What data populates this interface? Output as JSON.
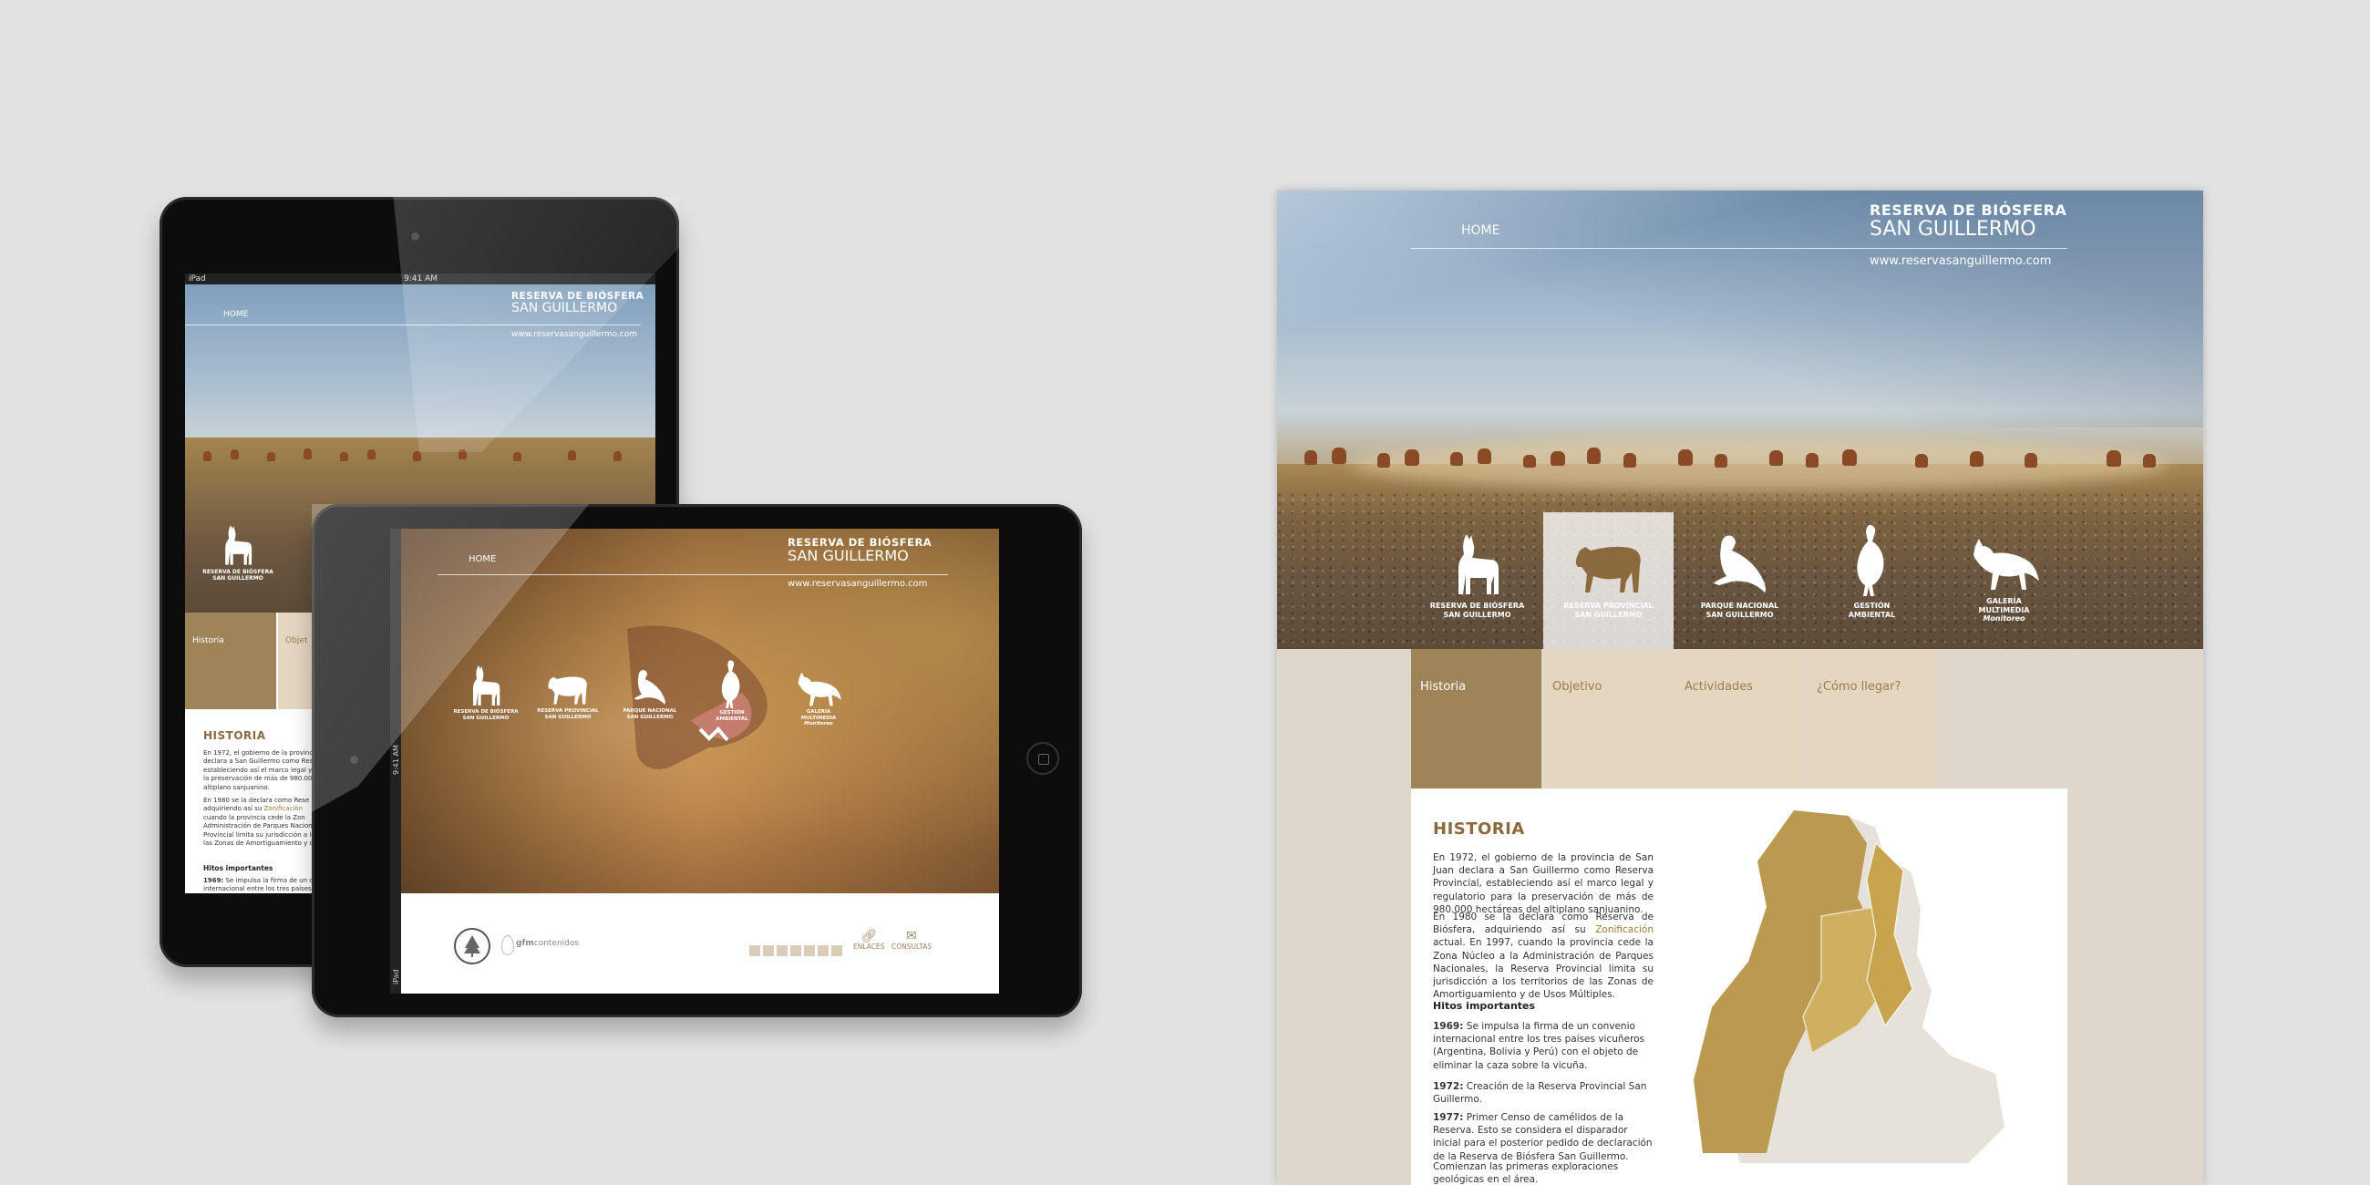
{
  "site": {
    "brand_line1": "RESERVA DE BIÓSFERA",
    "brand_line2": "SAN GUILLERMO",
    "url": "www.reservasanguillermo.com",
    "nav_home": "HOME",
    "animals": [
      {
        "icon": "vicuna-icon",
        "line1": "RESERVA DE BIÓSFERA",
        "line2": "SAN GUILLERMO"
      },
      {
        "icon": "puma-icon",
        "line1": "RESERVA PROVINCIAL",
        "line2": "SAN GUILLERMO"
      },
      {
        "icon": "condor-icon",
        "line1": "PARQUE NACIONAL",
        "line2": "SAN GUILLERMO"
      },
      {
        "icon": "rhea-icon",
        "line1": "GESTIÓN",
        "line2": "AMBIENTAL"
      },
      {
        "icon": "fox-icon",
        "line1": "GALERÍA",
        "line2": "MULTIMEDIA",
        "line3": "Monitoreo"
      }
    ],
    "tabs": [
      "Historia",
      "Objetivo",
      "Actividades",
      "¿Cómo llegar?"
    ],
    "historia_title": "HISTORIA",
    "para1": "En 1972, el gobierno de la provincia de San Juan declara a San Guillermo como Reserva Provincial, estableciendo así el marco legal y regulatorio para la preservación de más de 980.000 hectáreas del altiplano sanjuanino.",
    "para2_a": "En 1980 se la declara como Reserva de Biósfera, adquiriendo así su ",
    "para2_link": "Zonificación",
    "para2_b": " actual. En 1997, cuando la provincia cede la Zona Núcleo a la Administración de Parques Nacionales, la Reserva Provincial limita su jurisdicción a los territorios de las Zonas de Amortiguamiento y de Usos Múltiples.",
    "hitos_title": "Hitos importantes",
    "hitos": [
      {
        "year": "1969:",
        "text": " Se impulsa la firma de un convenio internacional entre los tres países vicuñeros (Argentina, Bolivia y Perú) con el objeto de eliminar la caza sobre la vicuña."
      },
      {
        "year": "1972:",
        "text": " Creación de la Reserva Provincial San Guillermo."
      },
      {
        "year": "1977:",
        "text": " Primer Censo de camélidos de la Reserva. Esto se considera el disparador inicial para el posterior pedido de declaración de la Reserva de Biósfera San Guillermo."
      }
    ],
    "closing": "Comienzan las primeras exploraciones geológicas en el área."
  },
  "ipad_portrait": {
    "status_left": "iPad",
    "status_time": "9:41 AM",
    "tab": "Historia",
    "tab2_partial": "Objet",
    "animals_partial": [
      {
        "line1": "RESERVA DE BIÓSFERA",
        "line2": "SAN GUILLERMO"
      }
    ],
    "text_lines": [
      "En 1972, el gobierno de la provincia",
      "declara a San Guillermo como Res",
      "estableciendo así el marco legal y",
      "la preservación de más de 980.00",
      "altiplano sanjuanino."
    ],
    "text_lines2": [
      "En 1980 se la declara como Rese",
      "adquiriendo así su ",
      "cuando la provincia cede la Zon",
      "Administración de Parques Nacion",
      "Provincial limita su jurisdicción a lo",
      "las Zonas de Amortiguamiento y de"
    ],
    "link_partial": "Zonificación",
    "hito_partial_year": "1969:",
    "hito_partial_text": " Se impulsa la firma de un co",
    "hito_partial_line2": "internacional entre los tres países"
  },
  "ipad_landscape": {
    "status_time": "9:41 AM",
    "status_left": "iPad",
    "footer_logo_text_a": "gfm",
    "footer_logo_text_b": "contenidos",
    "enlaces": "ENLACES",
    "consultas": "CONSULTAS",
    "social_icons": [
      "facebook-icon",
      "google-icon",
      "twitter-icon",
      "linkedin-icon",
      "youtube-icon",
      "flickr-icon",
      "pinterest-icon"
    ]
  },
  "colors": {
    "tab_active": "#a08459",
    "tab_inactive": "#e4d6c1",
    "tab_text_inactive": "#9b7d4f",
    "page_bg": "#ded7cc",
    "accent_gold": "#c8a54d",
    "heading_brown": "#8a6a3e"
  }
}
